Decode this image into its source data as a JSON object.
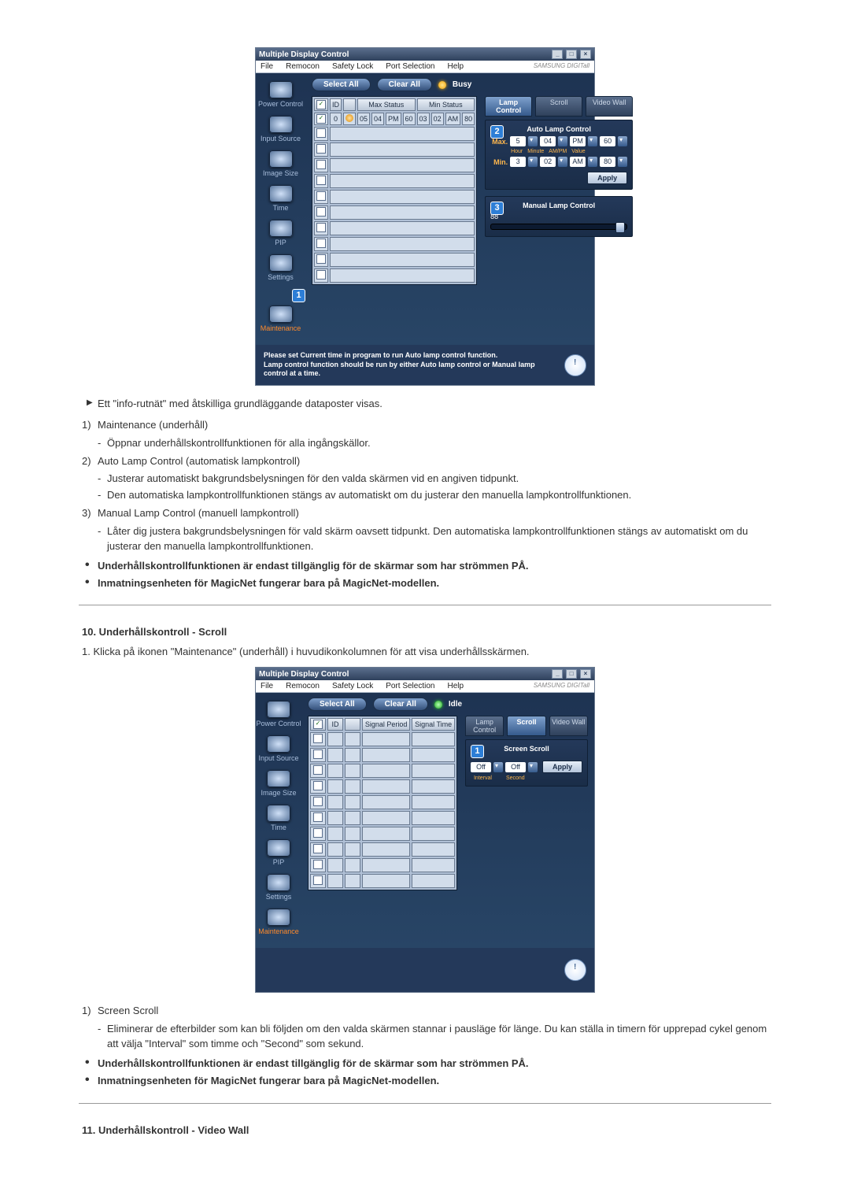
{
  "app": {
    "title": "Multiple Display Control",
    "brand": "SAMSUNG DIGITall",
    "menus": [
      "File",
      "Remocon",
      "Safety Lock",
      "Port Selection",
      "Help"
    ],
    "window_buttons": [
      "_",
      "□",
      "×"
    ]
  },
  "sidebar_items": [
    {
      "label": "Power Control"
    },
    {
      "label": "Input Source"
    },
    {
      "label": "Image Size"
    },
    {
      "label": "Time"
    },
    {
      "label": "PIP"
    },
    {
      "label": "Settings"
    },
    {
      "label": "Maintenance"
    }
  ],
  "fig1": {
    "select_all": "Select All",
    "clear_all": "Clear All",
    "status_text": "Busy",
    "grid_headers": {
      "id": "ID",
      "icon": "",
      "max": "Max Status",
      "min": "Min Status"
    },
    "row0": {
      "id": "0",
      "maxH": "05",
      "maxM": "04",
      "maxAP": "PM",
      "maxV": "60",
      "minH": "03",
      "minM": "02",
      "minAP": "AM",
      "minV": "80"
    },
    "tabs": {
      "lamp": "Lamp Control",
      "scroll": "Scroll",
      "video": "Video Wall"
    },
    "panel_auto_title": "Auto Lamp Control",
    "max_label": "Max.",
    "min_label": "Min.",
    "max": {
      "hour": "5",
      "minute": "04",
      "ampm": "PM",
      "value": "60"
    },
    "min": {
      "hour": "3",
      "minute": "02",
      "ampm": "AM",
      "value": "80"
    },
    "sublabels": {
      "hour": "Hour",
      "minute": "Minute",
      "ampm": "AM/PM",
      "value": "Value"
    },
    "apply": "Apply",
    "panel_manual_title": "Manual Lamp Control",
    "manual_value": "88",
    "footer_line1": "Please set Current time in program to run Auto lamp control function.",
    "footer_line2": "Lamp control function should be run by either Auto lamp control or Manual lamp control at a time.",
    "callout1": "1",
    "callout2": "2",
    "callout3": "3"
  },
  "body1": {
    "p_infonet": "Ett \"info-rutnät\" med åtskilliga grundläggande dataposter visas.",
    "n1": "Maintenance (underhåll)",
    "n1_sub": "Öppnar underhållskontrollfunktionen för alla ingångskällor.",
    "n2": "Auto Lamp Control (automatisk lampkontroll)",
    "n2_sub1": "Justerar automatiskt bakgrundsbelysningen för den valda skärmen vid en angiven tidpunkt.",
    "n2_sub2": "Den automatiska lampkontrollfunktionen stängs av automatiskt om du justerar den manuella lampkontrollfunktionen.",
    "n3": "Manual Lamp Control (manuell lampkontroll)",
    "n3_sub": "Låter dig justera bakgrundsbelysningen för vald skärm oavsett tidpunkt. Den automatiska lampkontrollfunktionen stängs av automatiskt om du justerar den manuella lampkontrollfunktionen.",
    "b1": "Underhållskontrollfunktionen är endast tillgänglig för de skärmar som har strömmen PÅ.",
    "b2": "Inmatningsenheten för MagicNet fungerar bara på MagicNet-modellen."
  },
  "sect10": {
    "title": "10. Underhållskontroll - Scroll",
    "step1": "1.  Klicka på ikonen \"Maintenance\" (underhåll) i huvudikonkolumnen för att visa underhållsskärmen."
  },
  "fig2": {
    "status_text": "Idle",
    "grid_headers": {
      "id": "ID",
      "icon": "",
      "sp": "Signal Period",
      "st": "Signal Time"
    },
    "tabs": {
      "lamp": "Lamp Control",
      "scroll": "Scroll",
      "video": "Video Wall"
    },
    "panel_title": "Screen Scroll",
    "interval_label": "Interval",
    "second_label": "Second",
    "opt_off": "Off",
    "apply": "Apply",
    "callout1": "1"
  },
  "body2": {
    "n1": "Screen Scroll",
    "n1_sub": "Eliminerar de efterbilder som kan bli följden om den valda skärmen stannar i pausläge för länge. Du kan ställa in timern för upprepad cykel genom att välja \"Interval\" som timme och \"Second\" som sekund.",
    "b1": "Underhållskontrollfunktionen är endast tillgänglig för de skärmar som har strömmen PÅ.",
    "b2": "Inmatningsenheten för MagicNet fungerar bara på MagicNet-modellen."
  },
  "sect11": {
    "title": "11. Underhållskontroll - Video Wall"
  }
}
